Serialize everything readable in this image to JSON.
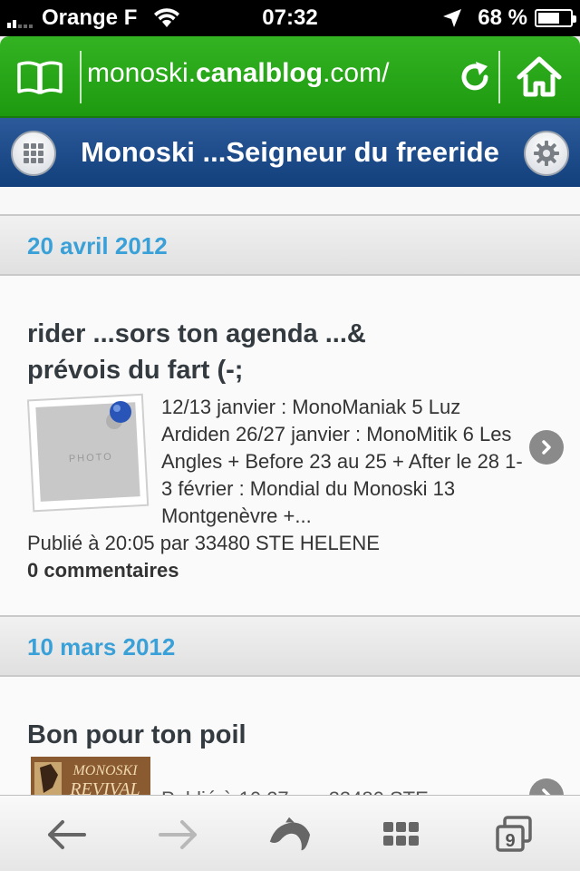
{
  "status_bar": {
    "carrier": "Orange F",
    "time": "07:32",
    "battery": "68 %",
    "battery_level": 0.68
  },
  "url_bar": {
    "url_prefix": "monoski.",
    "url_domain": "canalblog",
    "url_suffix": ".com/"
  },
  "blog": {
    "title": "Monoski ...Seigneur du freeride"
  },
  "posts": [
    {
      "date": "20 avril 2012",
      "title_line1": "rider ...sors ton agenda ...&",
      "title_line2": "prévois du fart (-;",
      "thumb_label": "PHOTO",
      "excerpt": " 12/13 janvier : MonoManiak 5  Luz Ardiden 26/27 janvier : MonoMitik 6  Les Angles + Before 23 au 25 + After le 28 1-3 février : Mondial du Monoski 13  Montgenèvre +...",
      "meta": "Publié à 20:05 par 33480 STE HELENE",
      "comments": "0 commentaires"
    },
    {
      "date": "10 mars 2012",
      "title": "Bon pour ton poil",
      "thumb_text_line1": "MONOSKI",
      "thumb_text_line2": "REVIVAL",
      "excerpt_partial": "Publié à 10:27 par 33480 STE"
    }
  ],
  "colors": {
    "url_bar_green": "#2aa81a",
    "blog_bar_blue": "#1d4a88",
    "date_blue": "#3aa0d8"
  }
}
